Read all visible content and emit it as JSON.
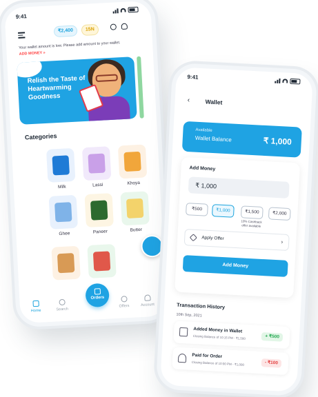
{
  "phone1": {
    "status_time": "9:41",
    "header": {
      "wallet_pill": "₹2,400",
      "coins_pill": "15N"
    },
    "notice": "Your wallet amount is low. Please add amount to your wallet.",
    "notice_link": "ADD MONEY »",
    "banner": {
      "text": "Relish the Taste of Heartwarming Goodness"
    },
    "categories_title": "Categories",
    "categories": [
      {
        "label": "Milk",
        "color": "#e8f1fd"
      },
      {
        "label": "Lassi",
        "color": "#f1e9fb"
      },
      {
        "label": "Khoya",
        "color": "#fdf1e3"
      },
      {
        "label": "Ghee",
        "color": "#e8f1fd"
      },
      {
        "label": "Paneer",
        "color": "#fdf5e3"
      },
      {
        "label": "Butter",
        "color": "#e9f7ec"
      }
    ],
    "nav": {
      "home": "Home",
      "search": "Search",
      "orders": "Orders",
      "offers": "Offers",
      "account": "Account"
    }
  },
  "phone2": {
    "status_time": "9:41",
    "title": "Wallet",
    "balance": {
      "available": "Available",
      "label": "Wallet Balance",
      "amount": "₹ 1,000"
    },
    "add_money": {
      "title": "Add Money",
      "input_value": "₹ 1,000",
      "chips": [
        "₹500",
        "₹1,000",
        "₹1,500",
        "₹2,000"
      ],
      "chip_note": "10% Cashback offer available",
      "offer_label": "Apply Offer",
      "button": "Add Money"
    },
    "history": {
      "title": "Transaction History",
      "date": "10th Sep, 2021",
      "items": [
        {
          "title": "Added Money in Wallet",
          "sub": "Closing Balance of 10:15 PM - ₹1,500",
          "amount": "+ ₹500"
        },
        {
          "title": "Paid for Order",
          "sub": "Closing Balance of 10:00 PM - ₹1,000",
          "amount": "- ₹100"
        }
      ]
    }
  },
  "colors": {
    "accent": "#1fa3e3",
    "credit": "#23a850",
    "debit": "#e23b3b"
  }
}
